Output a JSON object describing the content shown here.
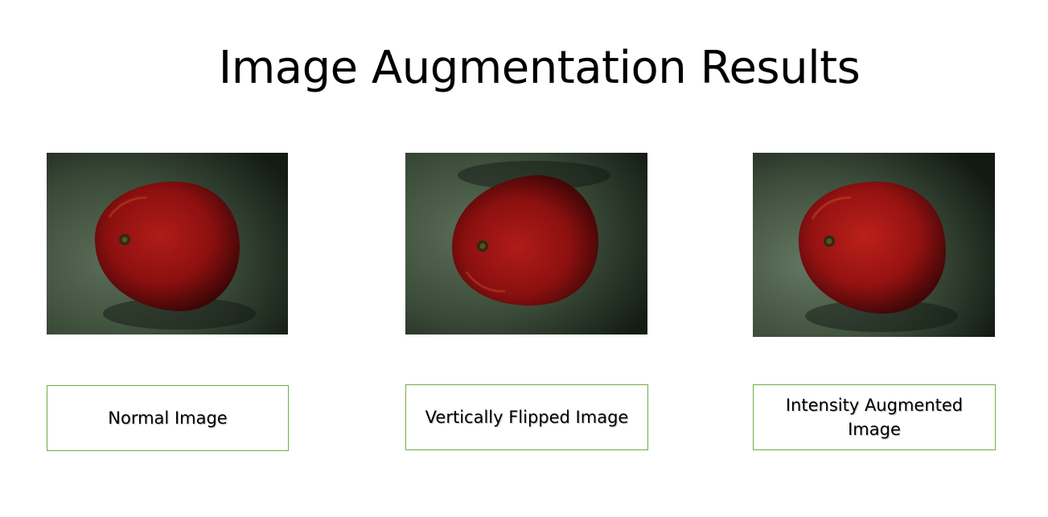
{
  "slide": {
    "title": "Image Augmentation Results"
  },
  "panels": [
    {
      "caption": "Normal Image",
      "image": "red-apple-photo"
    },
    {
      "caption": "Vertically Flipped Image",
      "image": "red-apple-photo-flipped"
    },
    {
      "caption": "Intensity Augmented Image",
      "image": "red-apple-photo-intensity"
    }
  ],
  "colors": {
    "caption_border": "#70ad47",
    "background_green": "#3e4f3c",
    "apple_red": "#9e1414"
  }
}
